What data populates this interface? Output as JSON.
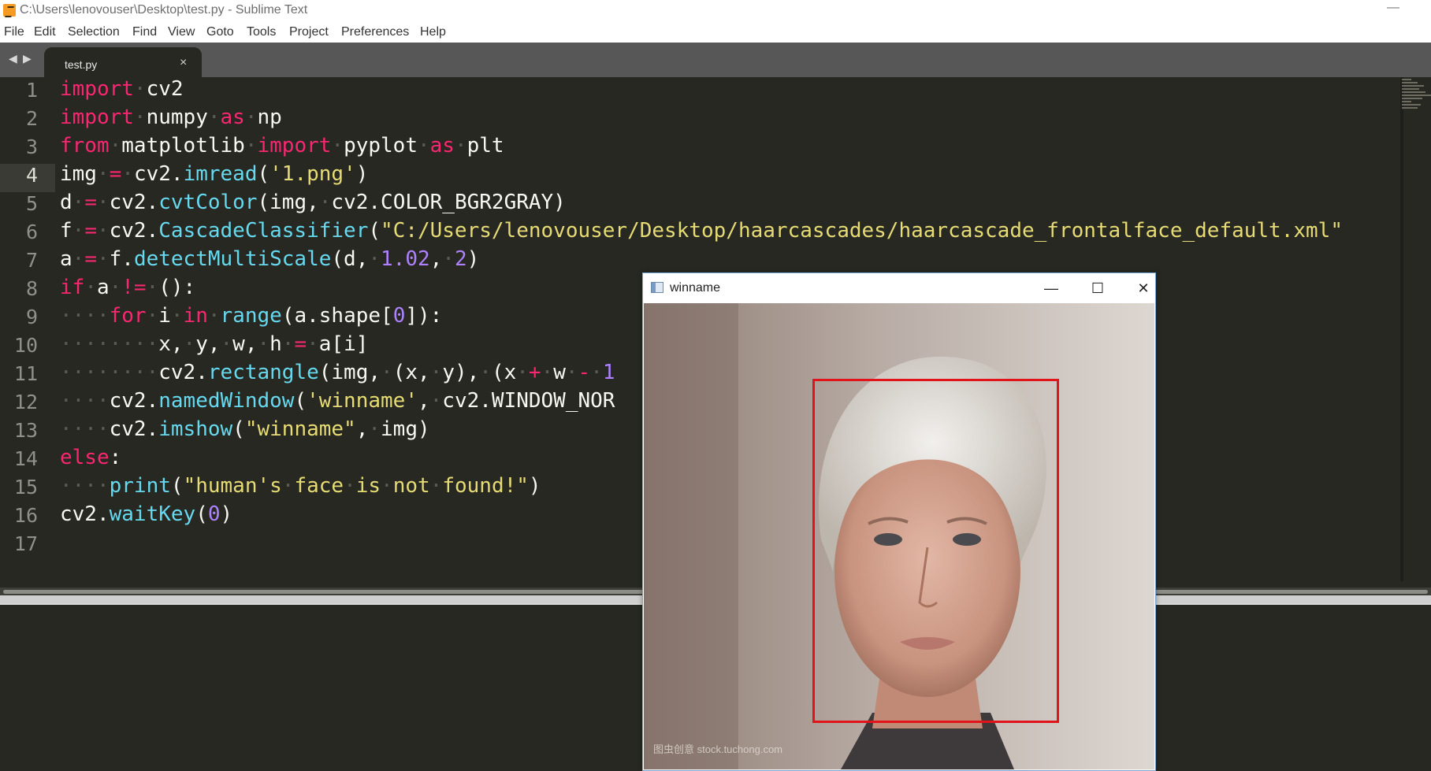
{
  "window": {
    "title": "C:\\Users\\lenovouser\\Desktop\\test.py - Sublime Text",
    "minimize_glyph": "—"
  },
  "menu": [
    "File",
    "Edit",
    "Selection",
    "Find",
    "View",
    "Goto",
    "Tools",
    "Project",
    "Preferences",
    "Help"
  ],
  "tabs": {
    "back_glyph": "◀",
    "forward_glyph": "▶",
    "active_label": "test.py",
    "close_glyph": "×"
  },
  "editor": {
    "line_numbers": [
      "1",
      "2",
      "3",
      "4",
      "5",
      "6",
      "7",
      "8",
      "9",
      "10",
      "11",
      "12",
      "13",
      "14",
      "15",
      "16",
      "17"
    ],
    "active_line": "4",
    "lines": [
      "import cv2",
      "import numpy as np",
      "from matplotlib import pyplot as plt",
      "img = cv2.imread('1.png')",
      "d = cv2.cvtColor(img, cv2.COLOR_BGR2GRAY)",
      "f = cv2.CascadeClassifier(\"C:/Users/lenovouser/Desktop/haarcascades/haarcascade_frontalface_default.xml\"",
      "a = f.detectMultiScale(d, 1.02, 2)",
      "if a != ():",
      "    for i in range(a.shape[0]):",
      "        x, y, w, h = a[i]",
      "        cv2.rectangle(img, (x, y), (x + w - 1",
      "    cv2.namedWindow('winname', cv2.WINDOW_NOR",
      "    cv2.imshow(\"winname\", img)",
      "else:",
      "    print(\"human's face is not found!\")",
      "cv2.waitKey(0)",
      ""
    ]
  },
  "cv_window": {
    "title": "winname",
    "minimize_glyph": "—",
    "maximize_glyph": "☐",
    "close_glyph": "✕",
    "watermark": "图虫创意 stock.tuchong.com",
    "rect_color": "#e0141a"
  },
  "colors": {
    "editor_bg": "#272822",
    "keyword": "#f92672",
    "function": "#66d9ef",
    "string": "#e6db74",
    "number": "#ae81ff",
    "text": "#f8f8f2"
  }
}
